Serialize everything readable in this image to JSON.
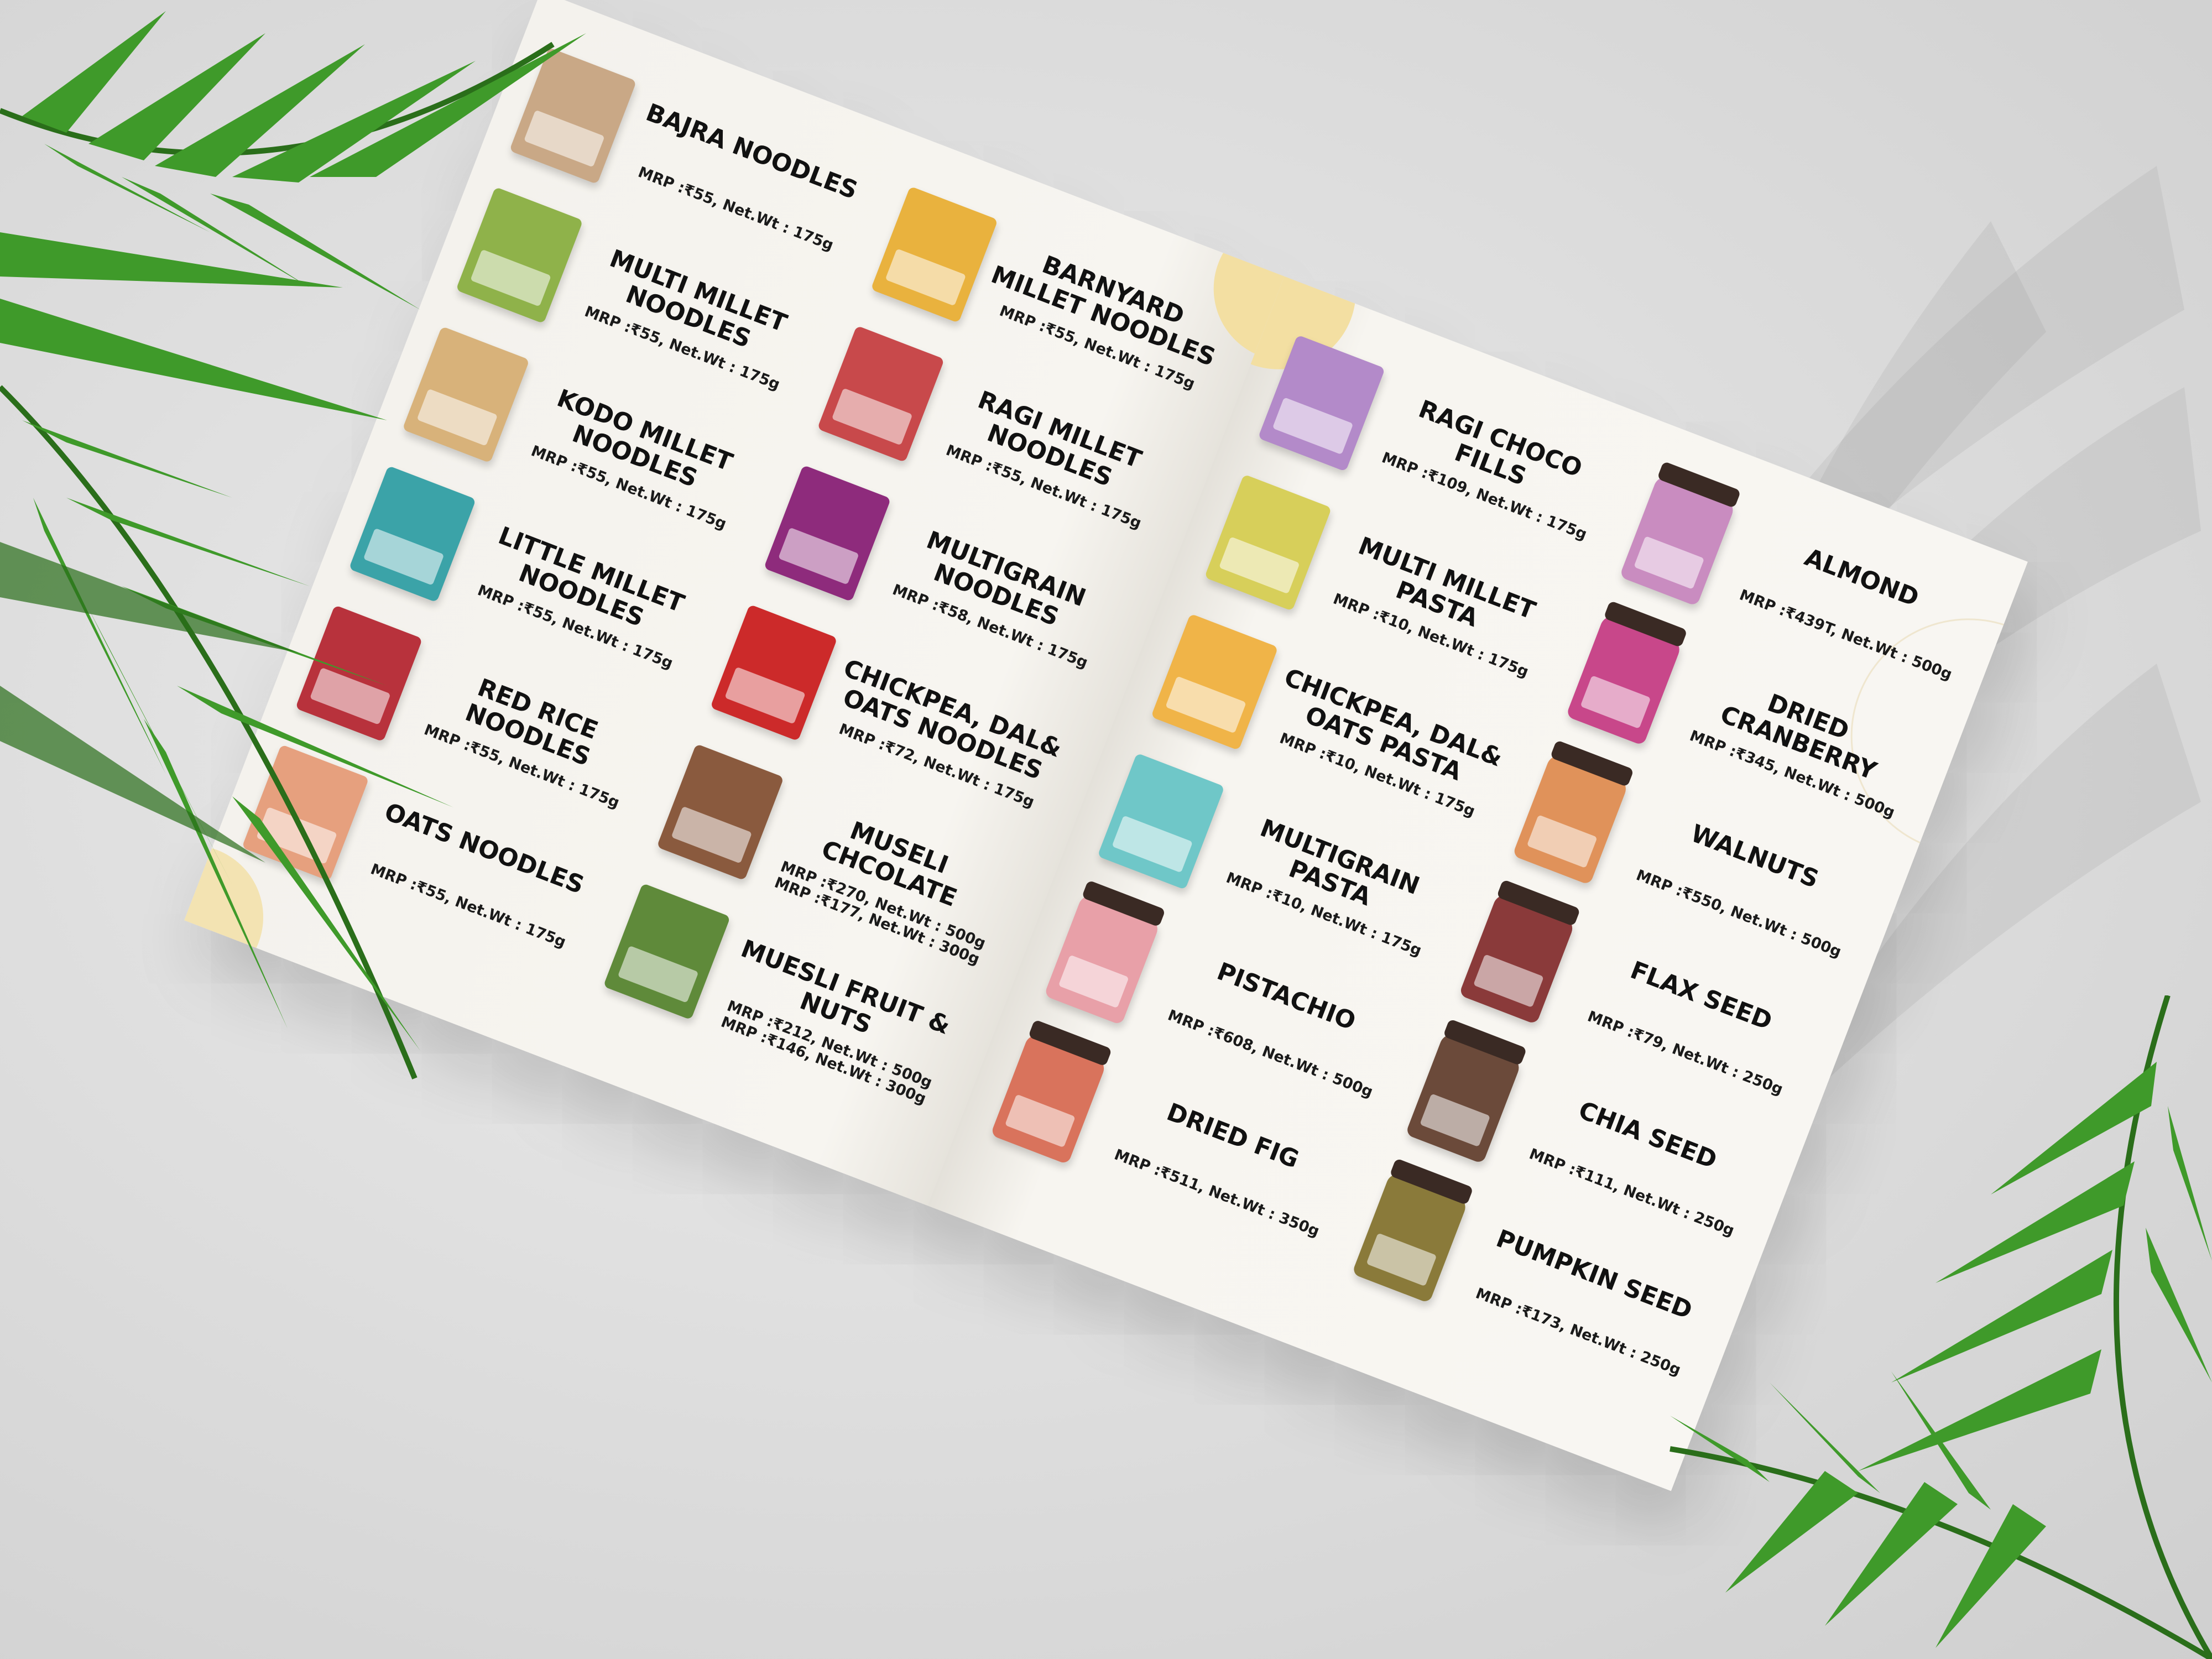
{
  "left_page": {
    "col1": [
      {
        "name": "BAJRA NOODLES",
        "prices": [
          "MRP :₹55, Net.Wt : 175g"
        ],
        "color": "#c9a886"
      },
      {
        "name": "MULTI MILLET NOODLES",
        "prices": [
          "MRP :₹55, Net.Wt : 175g"
        ],
        "color": "#8fb24a"
      },
      {
        "name": "KODO MILLET NOODLES",
        "prices": [
          "MRP :₹55, Net.Wt : 175g"
        ],
        "color": "#d8b27a"
      },
      {
        "name": "LITTLE MILLET NOODLES",
        "prices": [
          "MRP :₹55, Net.Wt : 175g"
        ],
        "color": "#3ba3a8"
      },
      {
        "name": "RED RICE NOODLES",
        "prices": [
          "MRP :₹55, Net.Wt : 175g"
        ],
        "color": "#b8323c"
      },
      {
        "name": "OATS NOODLES",
        "prices": [
          "MRP :₹55, Net.Wt : 175g"
        ],
        "color": "#e6a07e"
      }
    ],
    "col2": [
      {
        "name": "BARNYARD MILLET NOODLES",
        "prices": [
          "MRP :₹55, Net.Wt : 175g"
        ],
        "color": "#e9b23e"
      },
      {
        "name": "RAGI MILLET NOODLES",
        "prices": [
          "MRP :₹55, Net.Wt : 175g"
        ],
        "color": "#c8494b"
      },
      {
        "name": "MULTIGRAIN NOODLES",
        "prices": [
          "MRP :₹58, Net.Wt : 175g"
        ],
        "color": "#8e2b7c"
      },
      {
        "name": "CHICKPEA, DAL& OATS NOODLES",
        "prices": [
          "MRP :₹72, Net.Wt : 175g"
        ],
        "color": "#cc2a2a"
      },
      {
        "name": "MUSELI CHCOLATE",
        "prices": [
          "MRP :₹270, Net.Wt : 500g",
          "MRP :₹177, Net.Wt : 300g"
        ],
        "color": "#8a5a3e"
      },
      {
        "name": "MUESLI FRUIT & NUTS",
        "prices": [
          "MRP :₹212, Net.Wt : 500g",
          "MRP :₹146, Net.Wt : 300g"
        ],
        "color": "#5f8a3a"
      }
    ]
  },
  "right_page": {
    "col1": [
      {
        "name": "RAGI CHOCO FILLS",
        "prices": [
          "MRP :₹109, Net.Wt : 175g"
        ],
        "color": "#b38ac9",
        "jar": false
      },
      {
        "name": "MULTI MILLET PASTA",
        "prices": [
          "MRP :₹10, Net.Wt : 175g"
        ],
        "color": "#d7cf5a",
        "jar": false
      },
      {
        "name": "CHICKPEA, DAL& OATS PASTA",
        "prices": [
          "MRP :₹10, Net.Wt : 175g"
        ],
        "color": "#f0b448",
        "jar": false
      },
      {
        "name": "MULTIGRAIN PASTA",
        "prices": [
          "MRP :₹10, Net.Wt : 175g"
        ],
        "color": "#6fc7c8",
        "jar": false
      },
      {
        "name": "PISTACHIO",
        "prices": [
          "MRP :₹608, Net.Wt : 500g"
        ],
        "color": "#e8a0a8",
        "jar": true
      },
      {
        "name": "DRIED FIG",
        "prices": [
          "MRP :₹511, Net.Wt : 350g"
        ],
        "color": "#d9735c",
        "jar": true
      }
    ],
    "col2": [
      {
        "name": "ALMOND",
        "prices": [
          "MRP :₹439T, Net.Wt : 500g"
        ],
        "color": "#c98cc0",
        "jar": true
      },
      {
        "name": "DRIED CRANBERRY",
        "prices": [
          "MRP :₹345, Net.Wt : 500g"
        ],
        "color": "#c8478a",
        "jar": true
      },
      {
        "name": "WALNUTS",
        "prices": [
          "MRP :₹550, Net.Wt : 500g"
        ],
        "color": "#e0925a",
        "jar": true
      },
      {
        "name": "FLAX SEED",
        "prices": [
          "MRP :₹79, Net.Wt : 250g"
        ],
        "color": "#8a3a3a",
        "jar": true
      },
      {
        "name": "CHIA SEED",
        "prices": [
          "MRP :₹111, Net.Wt : 250g"
        ],
        "color": "#6b4a3a",
        "jar": true
      },
      {
        "name": "PUMPKIN SEED",
        "prices": [
          "MRP :₹173, Net.Wt : 250g"
        ],
        "color": "#8a7a3a",
        "jar": true
      }
    ]
  },
  "colors": {
    "accent_circle": "#f3dfa2",
    "paper": "#f6f4ef",
    "leaf": "#3f9a2a",
    "leaf_dark": "#2a6e1a"
  }
}
